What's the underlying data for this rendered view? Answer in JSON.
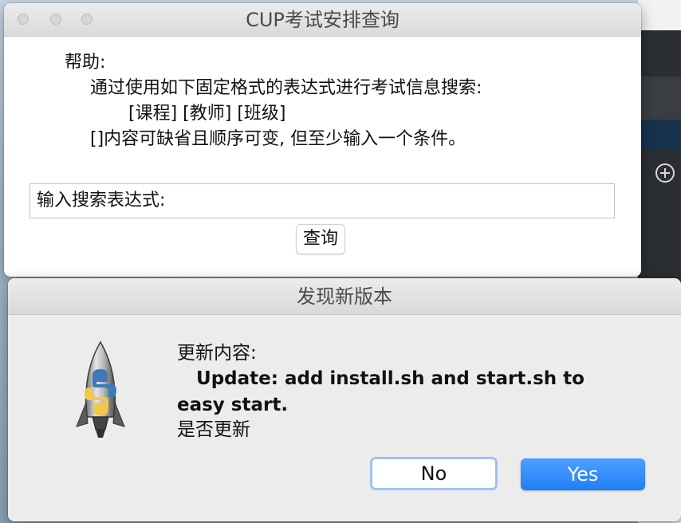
{
  "main_window": {
    "title": "CUP考试安排查询",
    "help": {
      "title": "帮助:",
      "line1": "通过使用如下固定格式的表达式进行考试信息搜索:",
      "line2": "[课程] [教师] [班级]",
      "line3": "[]内容可缺省且顺序可变, 但至少输入一个条件。"
    },
    "search": {
      "value": "输入搜索表达式:"
    },
    "query_button": "查询"
  },
  "dialog": {
    "title": "发现新版本",
    "heading": "更新内容:",
    "body": "   Update: add install.sh and start.sh to easy start.",
    "question": "是否更新",
    "no_label": "No",
    "yes_label": "Yes",
    "icon": "python-launcher-rocket-icon"
  },
  "colors": {
    "yes_button": "#1f7ef5",
    "no_button_focus_ring": "#9cc4f3",
    "titlebar": "#e3e3e3"
  }
}
